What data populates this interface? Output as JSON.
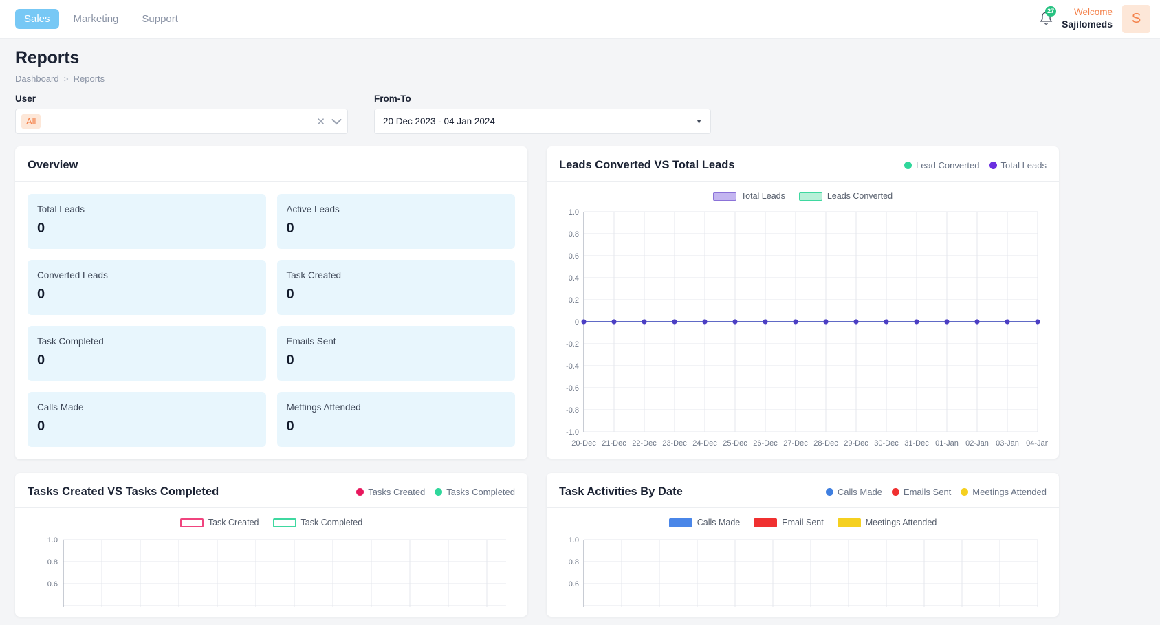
{
  "header": {
    "nav": [
      {
        "label": "Sales",
        "active": true
      },
      {
        "label": "Marketing",
        "active": false
      },
      {
        "label": "Support",
        "active": false
      }
    ],
    "notification_count": "27",
    "welcome_label": "Welcome",
    "user_name": "Sajilomeds",
    "avatar_initial": "S",
    "active_tab_color": "#77c8f5",
    "badge_color": "#27c281",
    "accent_color": "#f4814a"
  },
  "page": {
    "title": "Reports",
    "breadcrumb": {
      "root": "Dashboard",
      "separator": ">",
      "current": "Reports"
    }
  },
  "filters": {
    "user": {
      "label": "User",
      "selected_chip": "All",
      "clear_icon": "✕",
      "dropdown_icon": "⌄"
    },
    "date": {
      "label": "From-To",
      "value": "20 Dec 2023 - 04 Jan 2024",
      "caret_icon": "▼"
    }
  },
  "overview": {
    "title": "Overview",
    "tiles": [
      {
        "label": "Total Leads",
        "value": "0"
      },
      {
        "label": "Active Leads",
        "value": "0"
      },
      {
        "label": "Converted Leads",
        "value": "0"
      },
      {
        "label": "Task Created",
        "value": "0"
      },
      {
        "label": "Task Completed",
        "value": "0"
      },
      {
        "label": "Emails Sent",
        "value": "0"
      },
      {
        "label": "Calls Made",
        "value": "0"
      },
      {
        "label": "Mettings Attended",
        "value": "0"
      }
    ]
  },
  "panels": {
    "leads": {
      "title": "Leads Converted VS Total Leads",
      "header_legend": [
        {
          "label": "Lead Converted",
          "color": "#2fd79b"
        },
        {
          "label": "Total Leads",
          "color": "#6b2fe0"
        }
      ],
      "inner_legend": [
        {
          "label": "Total Leads",
          "fill": "#c3b5f0",
          "stroke": "#8b72d8"
        },
        {
          "label": "Leads Converted",
          "fill": "#b7f0d8",
          "stroke": "#3fd8a0"
        }
      ]
    },
    "tasks": {
      "title": "Tasks Created VS Tasks Completed",
      "header_legend": [
        {
          "label": "Tasks Created",
          "color": "#e8175d"
        },
        {
          "label": "Tasks Completed",
          "color": "#2fd79b"
        }
      ],
      "inner_legend": [
        {
          "label": "Task Created",
          "fill": "#ffffff",
          "stroke": "#f0447e"
        },
        {
          "label": "Task Completed",
          "fill": "#ffffff",
          "stroke": "#3fd8a0"
        }
      ]
    },
    "activities": {
      "title": "Task Activities By Date",
      "header_legend": [
        {
          "label": "Calls Made",
          "color": "#3f7fe0"
        },
        {
          "label": "Emails Sent",
          "color": "#f03030"
        },
        {
          "label": "Meetings Attended",
          "color": "#f5d020"
        }
      ],
      "inner_legend": [
        {
          "label": "Calls Made",
          "fill": "#4a86e8",
          "stroke": "#4a86e8"
        },
        {
          "label": "Email Sent",
          "fill": "#f03030",
          "stroke": "#f03030"
        },
        {
          "label": "Meetings Attended",
          "fill": "#f5d020",
          "stroke": "#f5d020"
        }
      ]
    }
  },
  "chart_data": [
    {
      "id": "leads",
      "type": "line",
      "title": "Leads Converted VS Total Leads",
      "xlabel": "",
      "ylabel": "",
      "ylim": [
        -1.0,
        1.0
      ],
      "yticks": [
        "1.0",
        "0.8",
        "0.6",
        "0.4",
        "0.2",
        "0",
        "-0.2",
        "-0.4",
        "-0.6",
        "-0.8",
        "-1.0"
      ],
      "categories": [
        "20-Dec",
        "21-Dec",
        "22-Dec",
        "23-Dec",
        "24-Dec",
        "25-Dec",
        "26-Dec",
        "27-Dec",
        "28-Dec",
        "29-Dec",
        "30-Dec",
        "31-Dec",
        "01-Jan",
        "02-Jan",
        "03-Jan",
        "04-Jan"
      ],
      "grid": true,
      "legend_position": "top-center",
      "series": [
        {
          "name": "Total Leads",
          "color": "#8b72d8",
          "values": [
            0,
            0,
            0,
            0,
            0,
            0,
            0,
            0,
            0,
            0,
            0,
            0,
            0,
            0,
            0,
            0
          ]
        },
        {
          "name": "Leads Converted",
          "color": "#3fd8a0",
          "values": [
            0,
            0,
            0,
            0,
            0,
            0,
            0,
            0,
            0,
            0,
            0,
            0,
            0,
            0,
            0,
            0
          ]
        }
      ]
    },
    {
      "id": "tasks",
      "type": "line",
      "title": "Tasks Created VS Tasks Completed",
      "ylim": [
        -1.0,
        1.0
      ],
      "yticks": [
        "1.0",
        "0.8",
        "0.6"
      ],
      "categories": [],
      "grid": true,
      "legend_position": "top-center",
      "series": [
        {
          "name": "Task Created",
          "color": "#f0447e",
          "values": []
        },
        {
          "name": "Task Completed",
          "color": "#3fd8a0",
          "values": []
        }
      ]
    },
    {
      "id": "activities",
      "type": "bar",
      "title": "Task Activities By Date",
      "ylim": [
        -1.0,
        1.0
      ],
      "yticks": [
        "1.0",
        "0.8",
        "0.6"
      ],
      "categories": [],
      "grid": true,
      "legend_position": "top-center",
      "series": [
        {
          "name": "Calls Made",
          "color": "#4a86e8",
          "values": []
        },
        {
          "name": "Email Sent",
          "color": "#f03030",
          "values": []
        },
        {
          "name": "Meetings Attended",
          "color": "#f5d020",
          "values": []
        }
      ]
    }
  ]
}
